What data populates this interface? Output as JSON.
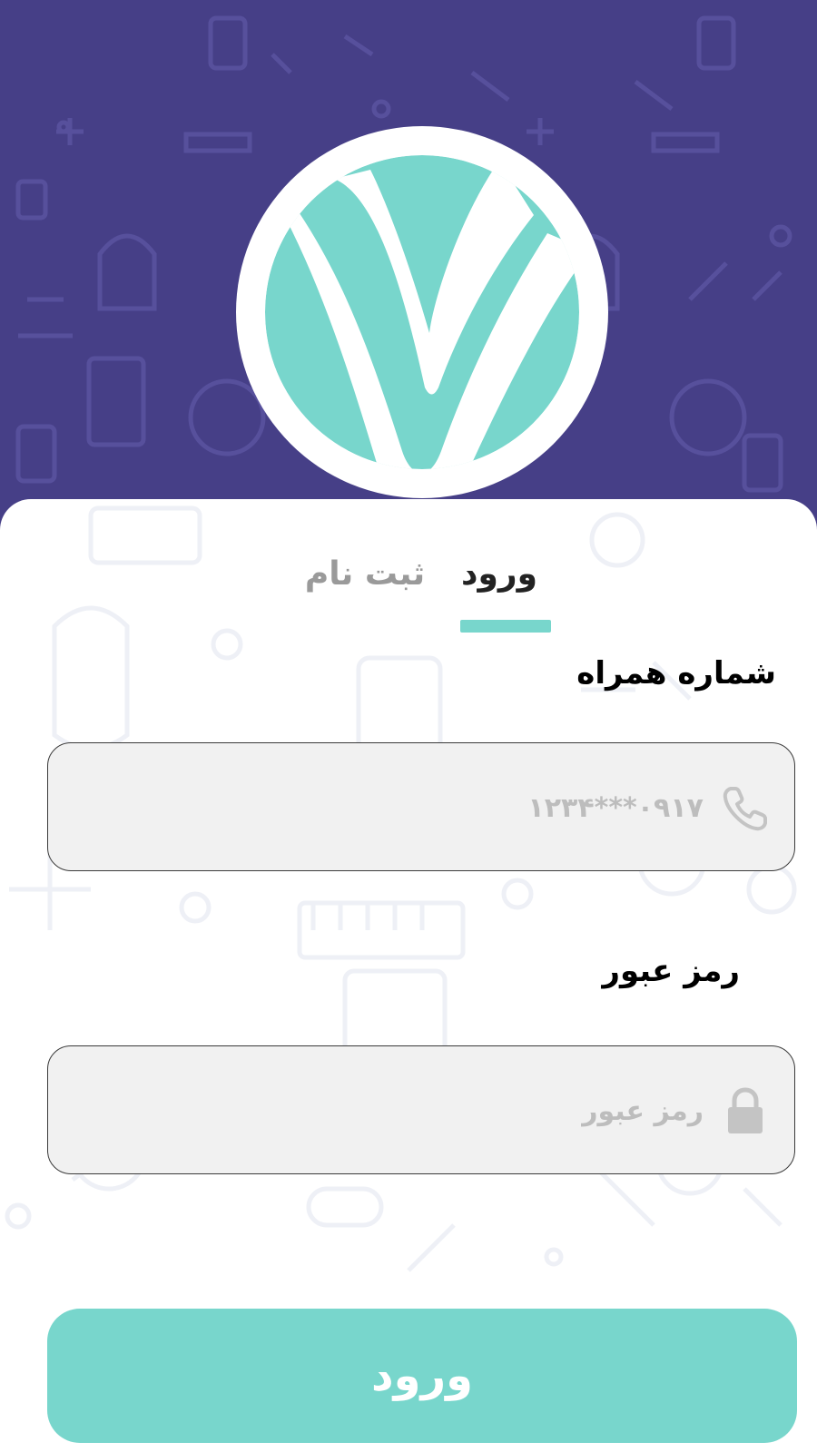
{
  "colors": {
    "header_background": "#463f87",
    "accent": "#78d6cc",
    "input_background": "#f1f1f1",
    "tab_active": "#222222",
    "tab_inactive": "#9a9a9a"
  },
  "logo": {
    "icon": "v-letter-logo-icon"
  },
  "tabs": [
    {
      "label": "ورود",
      "active": true
    },
    {
      "label": "ثبت نام",
      "active": false
    }
  ],
  "form": {
    "phone": {
      "label": "شماره همراه",
      "placeholder": "۰۹۱۷***۱۲۳۴",
      "value": "",
      "icon": "phone-icon"
    },
    "password": {
      "label": "رمز عبور",
      "placeholder": "رمز عبور",
      "value": "",
      "icon": "lock-icon"
    },
    "submit_label": "ورود"
  }
}
